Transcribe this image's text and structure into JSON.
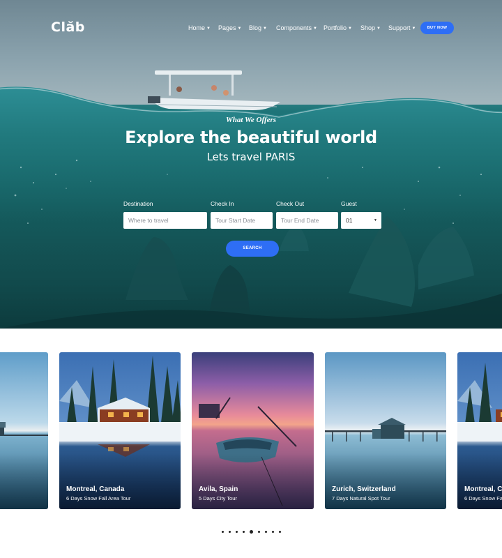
{
  "brand": {
    "logo": "Clăb"
  },
  "nav": {
    "items": [
      {
        "label": "Home"
      },
      {
        "label": "Pages"
      },
      {
        "label": "Blog"
      },
      {
        "label": "Components"
      },
      {
        "label": "Portfolio"
      },
      {
        "label": "Shop"
      },
      {
        "label": "Support"
      }
    ],
    "cta": "BUY NOW"
  },
  "hero": {
    "kicker": "What We Offers",
    "title": "Explore the beautiful world",
    "subtitle": "Lets travel PARIS"
  },
  "search_form": {
    "destination": {
      "label": "Destination",
      "placeholder": "Where to travel"
    },
    "check_in": {
      "label": "Check In",
      "placeholder": "Tour Start Date"
    },
    "check_out": {
      "label": "Check Out",
      "placeholder": "Tour End Date"
    },
    "guest": {
      "label": "Guest",
      "value": "01"
    },
    "submit": "SEARCH"
  },
  "tours": {
    "cards": [
      {
        "title": "",
        "subtitle": ""
      },
      {
        "title": "Montreal, Canada",
        "subtitle": "6 Days Snow Fall Area Tour"
      },
      {
        "title": "Avila, Spain",
        "subtitle": "5 Days City Tour"
      },
      {
        "title": "Zurich, Switzerland",
        "subtitle": "7 Days Natural Spot Tour"
      },
      {
        "title": "Montreal, Ca",
        "subtitle": "6 Days Snow Fa"
      }
    ],
    "pagination": {
      "total": 9,
      "active": 5
    }
  },
  "colors": {
    "accent": "#2e6ef5",
    "hero_water": "#1a6b6e"
  }
}
